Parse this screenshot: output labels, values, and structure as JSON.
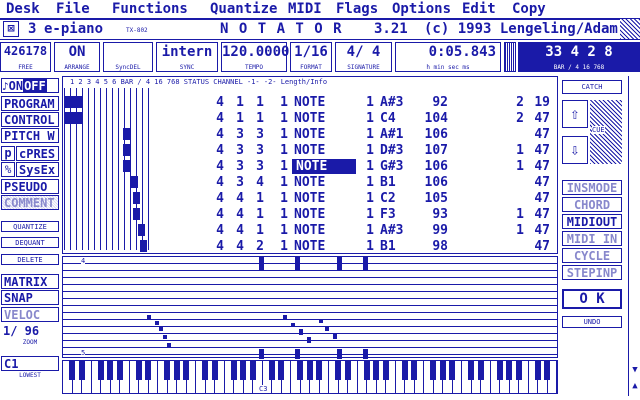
{
  "menu": [
    "Desk",
    "File",
    "Functions",
    "Quantize",
    "MIDI",
    "Flags",
    "Options",
    "Edit",
    "Copy"
  ],
  "title": {
    "close": "⊠",
    "track_num": "3",
    "track_name": "e-piano",
    "device": "TX-802",
    "app": "N O T A T O R",
    "version": "3.21",
    "copyright": "(c) 1993 Lengeling/Adam"
  },
  "status": {
    "free": {
      "value": "426178",
      "label": "FREE"
    },
    "arrange": {
      "value": "ON",
      "label": "ARRANGE"
    },
    "syncdel": {
      "value": "",
      "label": "SyncDEL"
    },
    "sync": {
      "value": "intern",
      "label": "SYNC"
    },
    "tempo": {
      "value": "120.0000",
      "label": "TEMPO"
    },
    "format": {
      "value": "1/16",
      "label": "FORMAT"
    },
    "signature": {
      "value": "4/ 4",
      "label": "SIGNATURE"
    },
    "time": {
      "value": "0:05.843",
      "label": "h   min   sec   ms"
    },
    "bar": {
      "value": "33  4  2  8",
      "label": "BAR  /  4  16  768"
    }
  },
  "left_panel": {
    "on_off": {
      "on": "ON",
      "off": "OFF"
    },
    "buttons": [
      "PROGRAM",
      "CONTROL",
      "PITCH W",
      "cPRES",
      "SysEx",
      "PSEUDO",
      "COMMENT"
    ],
    "p_label": "p",
    "x_label": "%",
    "quantize": "QUANTIZE",
    "dequant": "DEQUANT",
    "delete": "DELETE",
    "matrix": "MATRIX",
    "snap": "SNAP",
    "veloc": "VELOC",
    "zoom_value": "1/ 96",
    "zoom_label": "ZOOM",
    "lowest_value": "C1",
    "lowest_label": "LOWEST"
  },
  "table_header": {
    "bar_ruler": "1   2   3   4   5   6  BAR  /  4  16   768  STATUS  CHANNEL   -1-     -2-          Length/Info"
  },
  "events": [
    {
      "bar": "4",
      "beat": "1",
      "sixteenth": "1",
      "tick": "1",
      "status": "NOTE",
      "channel": "1",
      "note": "A#3",
      "velocity": "92",
      "len1": "2",
      "len2": "19",
      "selected": false
    },
    {
      "bar": "4",
      "beat": "1",
      "sixteenth": "1",
      "tick": "1",
      "status": "NOTE",
      "channel": "1",
      "note": "C4",
      "velocity": "104",
      "len1": "2",
      "len2": "47",
      "selected": false
    },
    {
      "bar": "4",
      "beat": "3",
      "sixteenth": "3",
      "tick": "1",
      "status": "NOTE",
      "channel": "1",
      "note": "A#1",
      "velocity": "106",
      "len1": "",
      "len2": "47",
      "selected": false
    },
    {
      "bar": "4",
      "beat": "3",
      "sixteenth": "3",
      "tick": "1",
      "status": "NOTE",
      "channel": "1",
      "note": "D#3",
      "velocity": "107",
      "len1": "1",
      "len2": "47",
      "selected": false
    },
    {
      "bar": "4",
      "beat": "3",
      "sixteenth": "3",
      "tick": "1",
      "status": "NOTE",
      "channel": "1",
      "note": "G#3",
      "velocity": "106",
      "len1": "1",
      "len2": "47",
      "selected": true
    },
    {
      "bar": "4",
      "beat": "3",
      "sixteenth": "4",
      "tick": "1",
      "status": "NOTE",
      "channel": "1",
      "note": "B1",
      "velocity": "106",
      "len1": "",
      "len2": "47",
      "selected": false
    },
    {
      "bar": "4",
      "beat": "4",
      "sixteenth": "1",
      "tick": "1",
      "status": "NOTE",
      "channel": "1",
      "note": "C2",
      "velocity": "105",
      "len1": "",
      "len2": "47",
      "selected": false
    },
    {
      "bar": "4",
      "beat": "4",
      "sixteenth": "1",
      "tick": "1",
      "status": "NOTE",
      "channel": "1",
      "note": "F3",
      "velocity": "93",
      "len1": "1",
      "len2": "47",
      "selected": false
    },
    {
      "bar": "4",
      "beat": "4",
      "sixteenth": "1",
      "tick": "1",
      "status": "NOTE",
      "channel": "1",
      "note": "A#3",
      "velocity": "99",
      "len1": "1",
      "len2": "47",
      "selected": false
    },
    {
      "bar": "4",
      "beat": "4",
      "sixteenth": "2",
      "tick": "1",
      "status": "NOTE",
      "channel": "1",
      "note": "B1",
      "velocity": "98",
      "len1": "",
      "len2": "47",
      "selected": false
    }
  ],
  "right_panel": {
    "catch": "CATCH",
    "up_arrow": "⇧",
    "down_arrow": "⇩",
    "cue": "CUE",
    "modes": [
      "INSMODE",
      "CHORD",
      "MIDIOUT",
      "MIDI IN",
      "CYCLE",
      "STEPINP"
    ],
    "ok": "O K",
    "undo": "UNDO"
  },
  "staff": {
    "bar_top": "4",
    "bar_bottom": "5"
  },
  "keyboard": {
    "label": "C3"
  },
  "colors": {
    "ink": "#1a1aa8",
    "paper": "#ffffff"
  }
}
